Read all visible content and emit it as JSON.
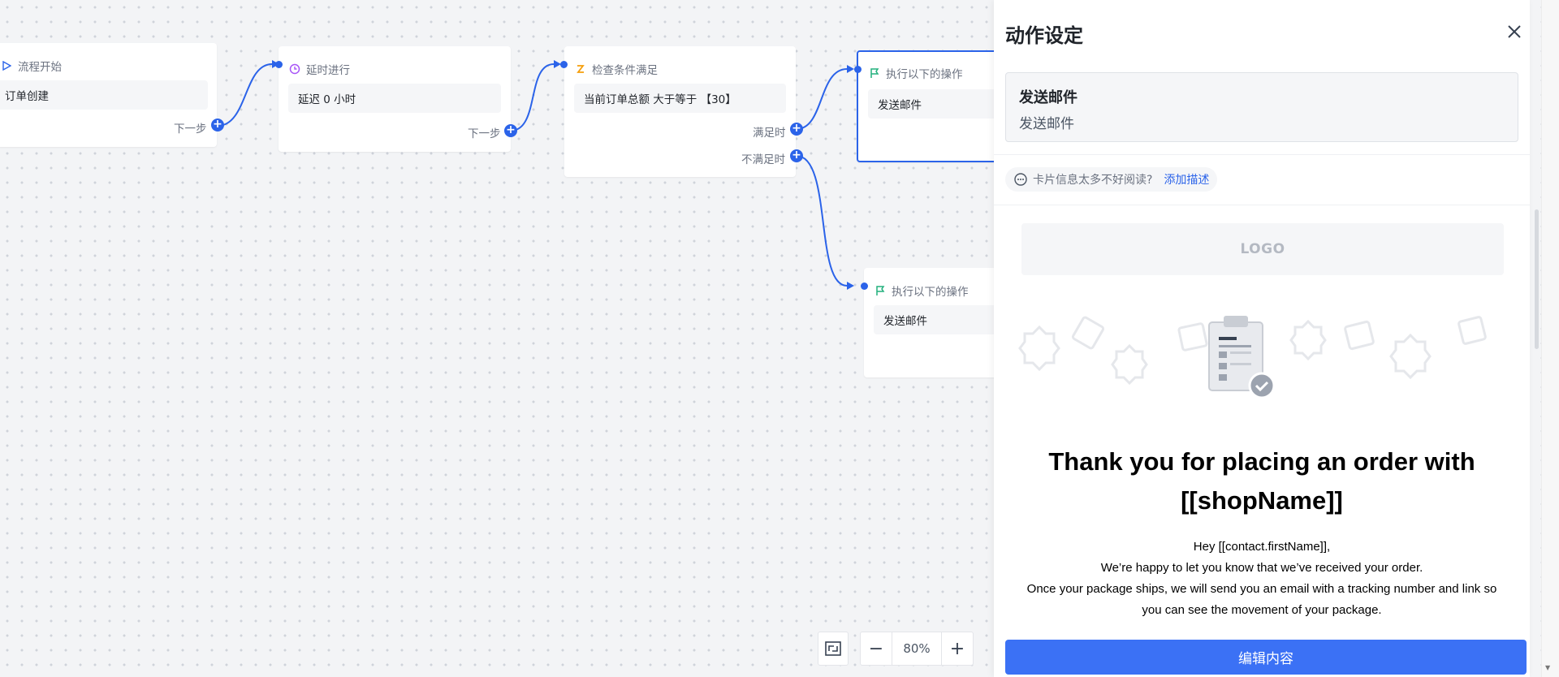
{
  "canvas": {
    "nodes": {
      "start": {
        "title": "流程开始",
        "body": "订单创建",
        "out_label": "下一步",
        "icon": "play-outline-icon"
      },
      "delay": {
        "title": "延时进行",
        "body": "延迟 0 小时",
        "out_label": "下一步",
        "icon": "clock-icon"
      },
      "condition": {
        "title": "检查条件满足",
        "body": "当前订单总额 大于等于 【30】",
        "yes_label": "满足时",
        "no_label": "不满足时",
        "icon": "branch-icon"
      },
      "action_yes": {
        "title": "执行以下的操作",
        "body": "发送邮件",
        "icon": "flag-icon"
      },
      "action_no": {
        "title": "执行以下的操作",
        "body": "发送邮件",
        "icon": "flag-icon"
      }
    },
    "zoom": {
      "value": "80%",
      "minus": "−",
      "plus": "+"
    }
  },
  "panel": {
    "title": "动作设定",
    "card": {
      "title": "发送邮件",
      "subtitle": "发送邮件"
    },
    "hint": {
      "text": "卡片信息太多不好阅读?",
      "link": "添加描述"
    },
    "preview": {
      "logo": "LOGO",
      "heading_line1": "Thank you for placing an order with",
      "heading_line2": "[[shopName]]",
      "body_lines": [
        "Hey [[contact.firstName]],",
        "We’re happy to let you know that we’ve received your order.",
        "Once your package ships, we will send you an email with a tracking number and link so",
        "you can see the movement of your package."
      ]
    },
    "edit_button": "编辑内容"
  },
  "colors": {
    "accent": "#2b63e9",
    "button": "#3b71f5",
    "action_flag": "#22b07d",
    "delay_icon": "#a855f7",
    "condition_icon": "#f59e0b"
  }
}
